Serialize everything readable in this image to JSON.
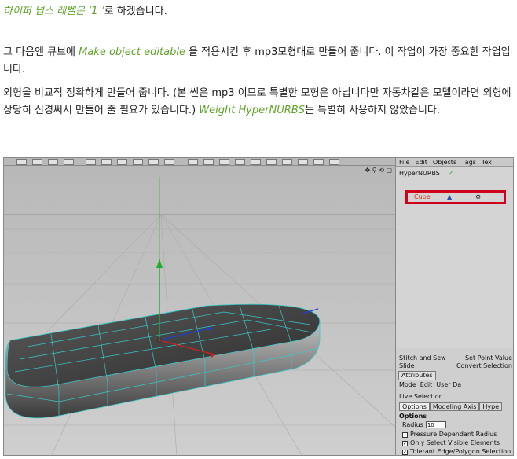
{
  "paragraphs": {
    "p1_green": "하이퍼 넙스 레벨은 ‘1 ’",
    "p1_rest": "로 하겠습니다.",
    "p2_a": "그 다음엔 큐브에 ",
    "p2_green": "Make object editable",
    "p2_b": " 을 적용시킨 후 mp3모형대로 만들어 줍니다. 이 작업이 가장 중요한 작업입니다.",
    "p3_a": "외형을 비교적 정확하게 만들어 줍니다. (본 씬은 mp3 이므로 특별한 모형은 아닙니다만 자동차같은 모델이라면 외형에 상당히 신경써서 만들어 줄 필요가 있습니다.) ",
    "p3_green": "Weight HyperNURBS",
    "p3_b": "는 특별히 사용하지 않았습니다."
  },
  "panel": {
    "menu": [
      "File",
      "Edit",
      "Objects",
      "Tags",
      "Tex"
    ],
    "hypernurbs": "HyperNURBS",
    "cube": "Cube",
    "stitch_label": "Stitch and Sew",
    "setpoint_label": "Set Point Value",
    "slide_label": "Slide",
    "convert_label": "Convert Selection",
    "attributes_tab": "Attributes",
    "attr_menu": [
      "Mode",
      "Edit",
      "User Da"
    ],
    "live_selection": "Live Selection",
    "subtabs": [
      "Options",
      "Modeling Axis",
      "Hype"
    ],
    "options_title": "Options",
    "radius_label": "Radius",
    "radius_value": "10",
    "pressure": "Pressure Dependant Radius",
    "only_visible": "Only Select Visible Elements",
    "tolerant": "Tolerant Edge/Polygon Selection"
  },
  "icons": {
    "viewport_nav": [
      "move-icon",
      "zoom-icon",
      "rotate-icon",
      "maximize-icon"
    ]
  },
  "colors": {
    "highlight_green": "#5fa32a",
    "selection_red": "#d0011b",
    "wire_cyan": "#39c9c9"
  }
}
